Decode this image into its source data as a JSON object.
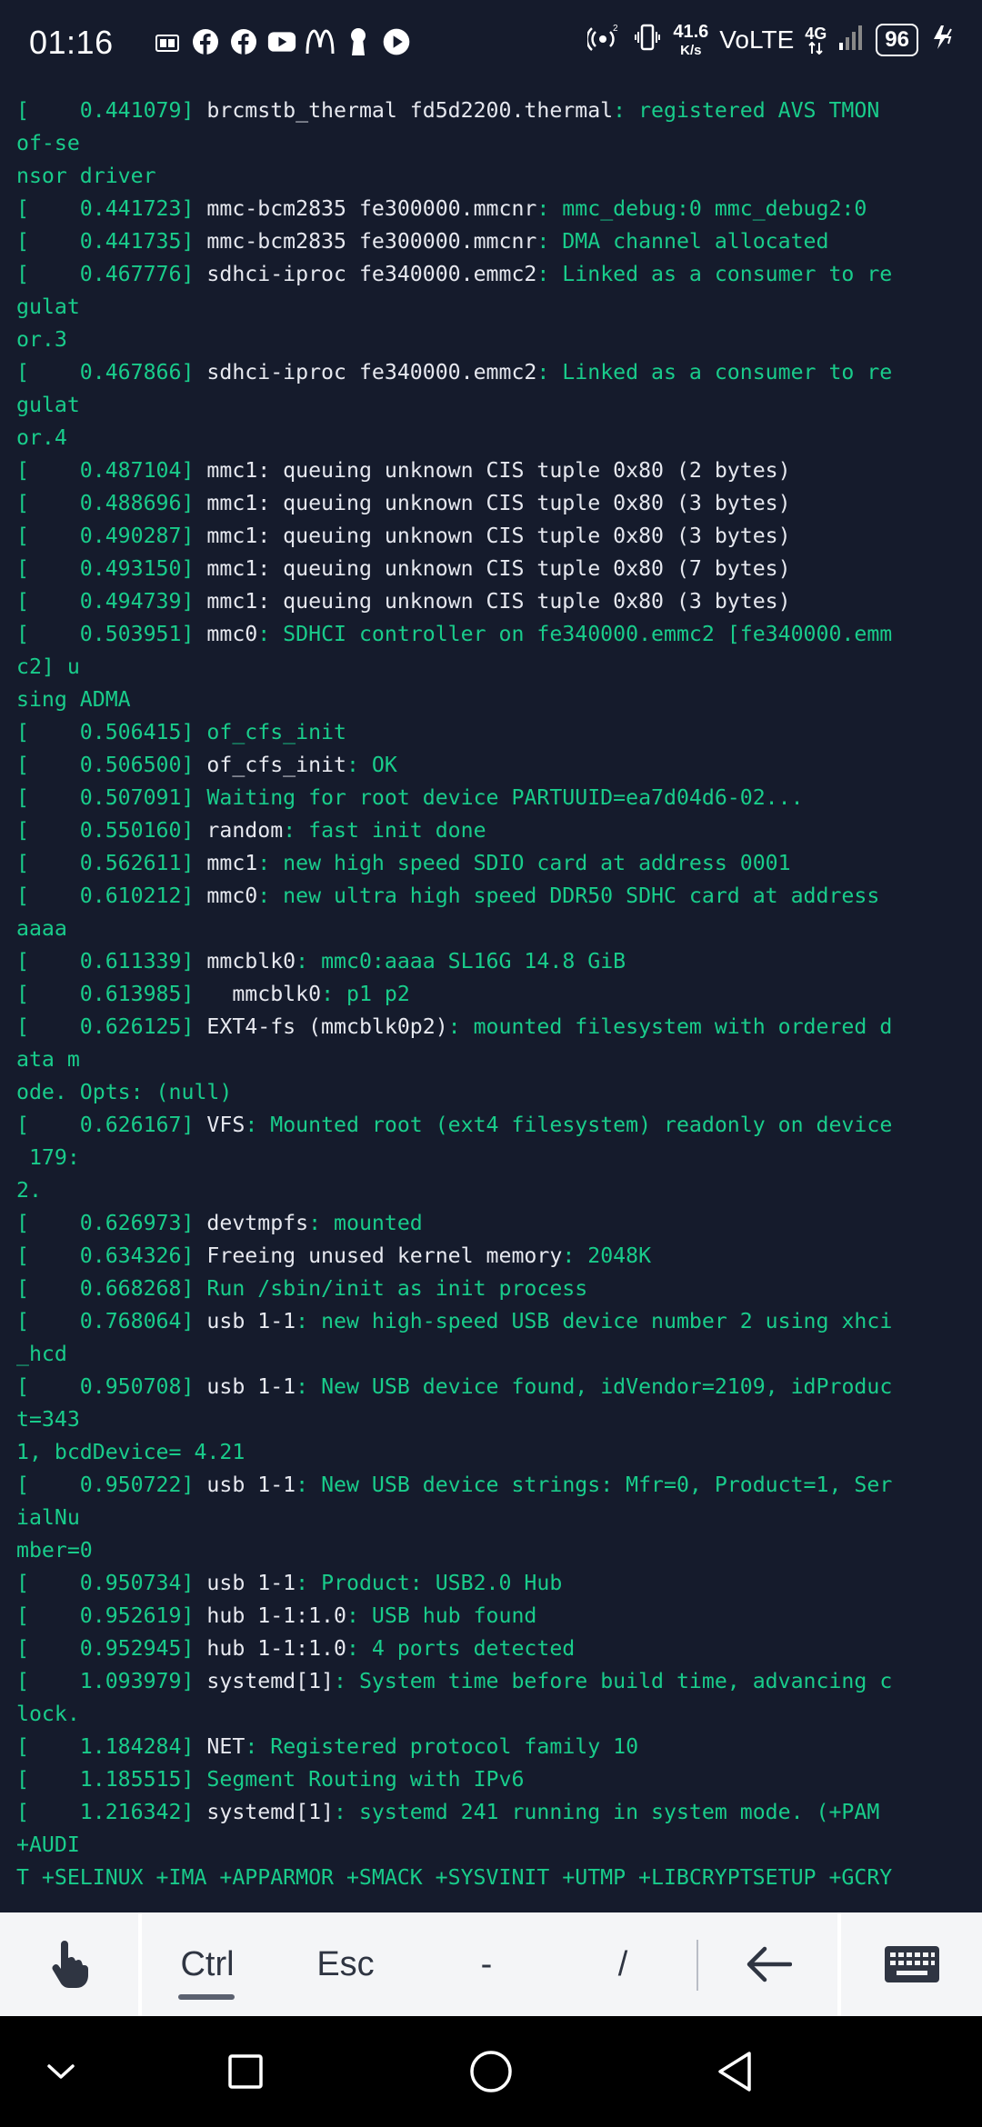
{
  "status_bar": {
    "time": "01:16",
    "speed_value": "41.6",
    "speed_unit": "K/s",
    "volte": "VoLTE",
    "network": "4G",
    "battery": "96",
    "notification_icons": [
      "tv-app-icon",
      "facebook-icon",
      "facebook-icon",
      "youtube-icon",
      "mcdonalds-icon",
      "keyhole-icon",
      "play-icon"
    ]
  },
  "terminal": {
    "lines": [
      {
        "ts": "[    0.441079]",
        "src": "brcmstb_thermal fd5d2200.thermal",
        "msg": ": registered AVS TMON"
      },
      {
        "ts": "",
        "src": "",
        "msg": "of-se"
      },
      {
        "ts": "",
        "src": "",
        "msg": "nsor driver"
      },
      {
        "ts": "[    0.441723]",
        "src": "mmc-bcm2835 fe300000.mmcnr",
        "msg": ": mmc_debug:0 mmc_debug2:0"
      },
      {
        "ts": "[    0.441735]",
        "src": "mmc-bcm2835 fe300000.mmcnr",
        "msg": ": DMA channel allocated"
      },
      {
        "ts": "[    0.467776]",
        "src": "sdhci-iproc fe340000.emmc2",
        "msg": ": Linked as a consumer to re"
      },
      {
        "ts": "",
        "src": "",
        "msg": "gulat"
      },
      {
        "ts": "",
        "src": "",
        "msg": "or.3"
      },
      {
        "ts": "[    0.467866]",
        "src": "sdhci-iproc fe340000.emmc2",
        "msg": ": Linked as a consumer to re"
      },
      {
        "ts": "",
        "src": "",
        "msg": "gulat"
      },
      {
        "ts": "",
        "src": "",
        "msg": "or.4"
      },
      {
        "ts": "[    0.487104]",
        "src": "mmc1: queuing unknown CIS tuple 0x80 (2 bytes)",
        "msg": ""
      },
      {
        "ts": "[    0.488696]",
        "src": "mmc1: queuing unknown CIS tuple 0x80 (3 bytes)",
        "msg": ""
      },
      {
        "ts": "[    0.490287]",
        "src": "mmc1: queuing unknown CIS tuple 0x80 (3 bytes)",
        "msg": ""
      },
      {
        "ts": "[    0.493150]",
        "src": "mmc1: queuing unknown CIS tuple 0x80 (7 bytes)",
        "msg": ""
      },
      {
        "ts": "[    0.494739]",
        "src": "mmc1: queuing unknown CIS tuple 0x80 (3 bytes)",
        "msg": ""
      },
      {
        "ts": "[    0.503951]",
        "src": "mmc0",
        "msg": ": SDHCI controller on fe340000.emmc2 [fe340000.emm"
      },
      {
        "ts": "",
        "src": "",
        "msg": "c2] u"
      },
      {
        "ts": "",
        "src": "",
        "msg": "sing ADMA"
      },
      {
        "ts": "[    0.506415]",
        "src": "",
        "msg": "of_cfs_init"
      },
      {
        "ts": "[    0.506500]",
        "src": "of_cfs_init",
        "msg": ": OK"
      },
      {
        "ts": "[    0.507091]",
        "src": "",
        "msg": "Waiting for root device PARTUUID=ea7d04d6-02..."
      },
      {
        "ts": "[    0.550160]",
        "src": "random",
        "msg": ": fast init done"
      },
      {
        "ts": "[    0.562611]",
        "src": "mmc1",
        "msg": ": new high speed SDIO card at address 0001"
      },
      {
        "ts": "[    0.610212]",
        "src": "mmc0",
        "msg": ": new ultra high speed DDR50 SDHC card at address"
      },
      {
        "ts": "",
        "src": "",
        "msg": "aaaa"
      },
      {
        "ts": "[    0.611339]",
        "src": "mmcblk0",
        "msg": ": mmc0:aaaa SL16G 14.8 GiB"
      },
      {
        "ts": "[    0.613985]",
        "src": "  mmcblk0",
        "msg": ": p1 p2"
      },
      {
        "ts": "[    0.626125]",
        "src": "EXT4-fs (mmcblk0p2)",
        "msg": ": mounted filesystem with ordered d"
      },
      {
        "ts": "",
        "src": "",
        "msg": "ata m"
      },
      {
        "ts": "",
        "src": "",
        "msg": "ode. Opts: (null)"
      },
      {
        "ts": "[    0.626167]",
        "src": "VFS",
        "msg": ": Mounted root (ext4 filesystem) readonly on device"
      },
      {
        "ts": "",
        "src": "",
        "msg": " 179:"
      },
      {
        "ts": "",
        "src": "",
        "msg": "2."
      },
      {
        "ts": "[    0.626973]",
        "src": "devtmpfs",
        "msg": ": mounted"
      },
      {
        "ts": "[    0.634326]",
        "src": "Freeing unused kernel memory",
        "msg": ": 2048K"
      },
      {
        "ts": "[    0.668268]",
        "src": "",
        "msg": "Run /sbin/init as init process"
      },
      {
        "ts": "[    0.768064]",
        "src": "usb 1-1",
        "msg": ": new high-speed USB device number 2 using xhci"
      },
      {
        "ts": "",
        "src": "",
        "msg": "_hcd"
      },
      {
        "ts": "[    0.950708]",
        "src": "usb 1-1",
        "msg": ": New USB device found, idVendor=2109, idProduc"
      },
      {
        "ts": "",
        "src": "",
        "msg": "t=343"
      },
      {
        "ts": "",
        "src": "",
        "msg": "1, bcdDevice= 4.21"
      },
      {
        "ts": "[    0.950722]",
        "src": "usb 1-1",
        "msg": ": New USB device strings: Mfr=0, Product=1, Ser"
      },
      {
        "ts": "",
        "src": "",
        "msg": "ialNu"
      },
      {
        "ts": "",
        "src": "",
        "msg": "mber=0"
      },
      {
        "ts": "[    0.950734]",
        "src": "usb 1-1",
        "msg": ": Product: USB2.0 Hub"
      },
      {
        "ts": "[    0.952619]",
        "src": "hub 1-1:1.0",
        "msg": ": USB hub found"
      },
      {
        "ts": "[    0.952945]",
        "src": "hub 1-1:1.0",
        "msg": ": 4 ports detected"
      },
      {
        "ts": "[    1.093979]",
        "src": "systemd[1]",
        "msg": ": System time before build time, advancing c"
      },
      {
        "ts": "",
        "src": "",
        "msg": "lock."
      },
      {
        "ts": "[    1.184284]",
        "src": "NET",
        "msg": ": Registered protocol family 10"
      },
      {
        "ts": "[    1.185515]",
        "src": "",
        "msg": "Segment Routing with IPv6"
      },
      {
        "ts": "[    1.216342]",
        "src": "systemd[1]",
        "msg": ": systemd 241 running in system mode. (+PAM"
      },
      {
        "ts": "",
        "src": "",
        "msg": "+AUDI"
      },
      {
        "ts": "",
        "src": "",
        "msg": "T +SELINUX +IMA +APPARMOR +SMACK +SYSVINIT +UTMP +LIBCRYPTSETUP +GCRY"
      }
    ]
  },
  "extra_keys": {
    "ctrl": "Ctrl",
    "esc": "Esc",
    "dash": "-",
    "slash": "/"
  },
  "colors": {
    "terminal_bg": "#151b2c",
    "log_green": "#19cc8b",
    "log_white": "#e6e8ef",
    "extra_keys_bg": "#f4f5f7"
  }
}
